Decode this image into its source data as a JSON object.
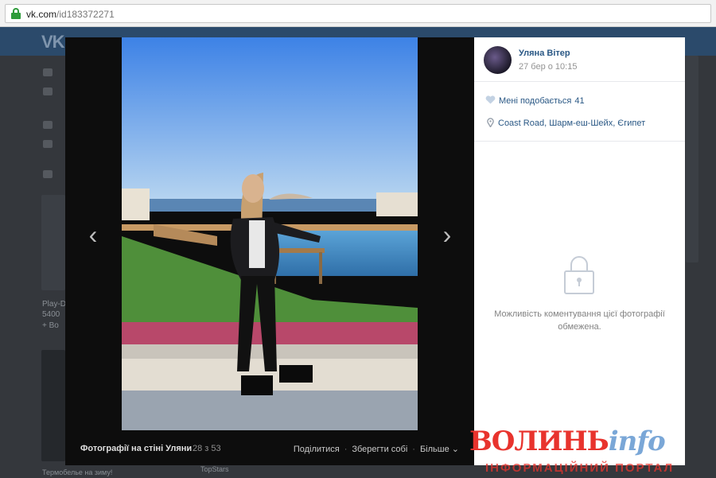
{
  "browser": {
    "url_host": "vk.com",
    "url_path": "/id183372271"
  },
  "background_page": {
    "logo": "VK",
    "card_title": "Play-D",
    "card_stat": "5400",
    "card_action": "+ Bo",
    "bottom_left_text": "Термобелье на зиму!",
    "bottom_mid_text": "TopStars"
  },
  "viewer": {
    "album_label": "Фотографії на стіні Уляни",
    "counter": "28 з 53",
    "action_share": "Поділитися",
    "action_save": "Зберегти собі",
    "action_more": "Більше",
    "prev_glyph": "‹",
    "next_glyph": "›"
  },
  "panel": {
    "author": "Уляна Вітер",
    "date": "27 бер о 10:15",
    "likes_label": "Мені подобається",
    "likes_count": "41",
    "location": "Coast Road, Шарм-еш-Шейх, Єгипет",
    "comments_notice": "Можливість коментування цієї фотографії обмежена."
  },
  "watermark": {
    "brand_red": "ВОЛИНЬ",
    "brand_blue": "info",
    "tagline": "ІНФОРМАЦІЙНИЙ ПОРТАЛ"
  },
  "colors": {
    "link": "#2a5885",
    "vk_header": "#2b4a6b",
    "secure_lock": "#2e9b3a",
    "watermark_red": "#e8332d"
  }
}
